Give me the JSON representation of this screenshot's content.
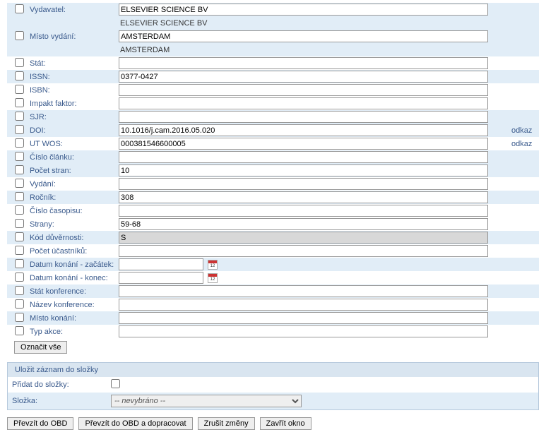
{
  "fields": [
    {
      "key": "publisher",
      "label": "Vydavatel:",
      "value": "ELSEVIER SCIENCE BV",
      "display": "ELSEVIER SCIENCE BV",
      "alt": true,
      "hasInput": true,
      "hasDisplay": true
    },
    {
      "key": "place",
      "label": "Místo vydání:",
      "value": "AMSTERDAM",
      "display": "AMSTERDAM",
      "alt": true,
      "hasInput": true,
      "hasDisplay": true
    },
    {
      "key": "state",
      "label": "Stát:",
      "value": "",
      "alt": false,
      "hasInput": true
    },
    {
      "key": "issn",
      "label": "ISSN:",
      "value": "0377-0427",
      "alt": true,
      "hasInput": true
    },
    {
      "key": "isbn",
      "label": "ISBN:",
      "value": "",
      "alt": false,
      "hasInput": true
    },
    {
      "key": "impact",
      "label": "Impakt faktor:",
      "value": "",
      "alt": false,
      "hasInput": true
    },
    {
      "key": "sjr",
      "label": "SJR:",
      "value": "",
      "alt": true,
      "hasInput": true
    },
    {
      "key": "doi",
      "label": "DOI:",
      "value": "10.1016/j.cam.2016.05.020",
      "alt": true,
      "hasInput": true,
      "link": "odkaz"
    },
    {
      "key": "utwos",
      "label": "UT WOS:",
      "value": "000381546600005",
      "alt": false,
      "hasInput": true,
      "link": "odkaz"
    },
    {
      "key": "articleno",
      "label": "Číslo článku:",
      "value": "",
      "alt": true,
      "hasInput": true
    },
    {
      "key": "pages",
      "label": "Počet stran:",
      "value": "10",
      "alt": true,
      "hasInput": true
    },
    {
      "key": "edition",
      "label": "Vydání:",
      "value": "",
      "alt": false,
      "hasInput": true
    },
    {
      "key": "volume",
      "label": "Ročník:",
      "value": "308",
      "alt": true,
      "hasInput": true
    },
    {
      "key": "issue",
      "label": "Číslo časopisu:",
      "value": "",
      "alt": false,
      "hasInput": true
    },
    {
      "key": "range",
      "label": "Strany:",
      "value": "59-68",
      "alt": false,
      "hasInput": true
    },
    {
      "key": "conf_code",
      "label": "Kód důvěrnosti:",
      "value": "S",
      "alt": true,
      "hasInput": true,
      "readonly": true
    },
    {
      "key": "participants",
      "label": "Počet účastníků:",
      "value": "",
      "alt": false,
      "hasInput": true
    },
    {
      "key": "date_start",
      "label": "Datum konání - začátek:",
      "value": "",
      "alt": true,
      "hasInput": true,
      "date": true
    },
    {
      "key": "date_end",
      "label": "Datum konání - konec:",
      "value": "",
      "alt": false,
      "hasInput": true,
      "date": true
    },
    {
      "key": "conf_state",
      "label": "Stát konference:",
      "value": "",
      "alt": true,
      "hasInput": true
    },
    {
      "key": "conf_name",
      "label": "Název konference:",
      "value": "",
      "alt": false,
      "hasInput": true
    },
    {
      "key": "conf_place",
      "label": "Místo konání:",
      "value": "",
      "alt": true,
      "hasInput": true
    },
    {
      "key": "event_type",
      "label": "Typ akce:",
      "value": "",
      "alt": false,
      "hasInput": true
    }
  ],
  "buttons": {
    "select_all": "Označit vše",
    "take_obd": "Převzít do OBD",
    "take_obd_edit": "Převzít do OBD a dopracovat",
    "cancel": "Zrušit změny",
    "close": "Zavřít okno"
  },
  "panel": {
    "title": "Uložit záznam do složky",
    "add_label": "Přidat do složky:",
    "folder_label": "Složka:",
    "folder_value": "-- nevybráno --"
  }
}
